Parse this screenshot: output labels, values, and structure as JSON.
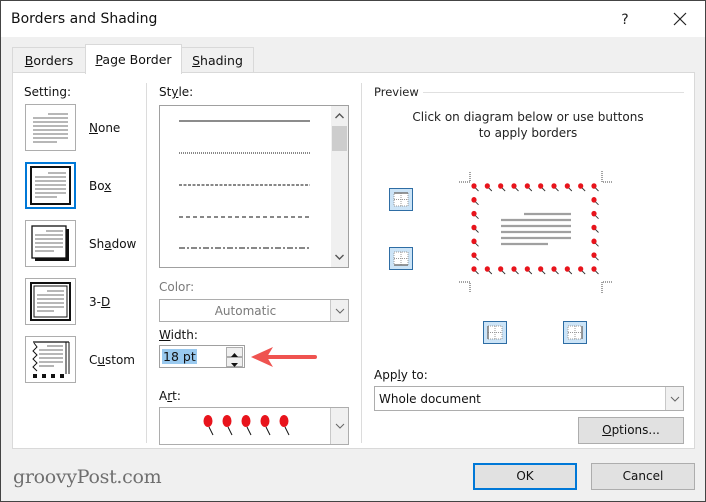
{
  "window": {
    "title": "Borders and Shading",
    "help_label": "?",
    "close_icon": "close-icon"
  },
  "tabs": [
    {
      "label": "Borders",
      "underline": "B",
      "rest": "orders",
      "active": false
    },
    {
      "label": "Page Border",
      "underline": "P",
      "rest": "age Border",
      "active": true
    },
    {
      "label": "Shading",
      "underline": "S",
      "rest": "hading",
      "active": false
    }
  ],
  "setting": {
    "label": "Setting:",
    "options": [
      {
        "pre": "",
        "u": "N",
        "post": "one",
        "label": "None",
        "selected": false
      },
      {
        "pre": "Bo",
        "u": "x",
        "post": "",
        "label": "Box",
        "selected": true
      },
      {
        "pre": "Sh",
        "u": "a",
        "post": "dow",
        "label": "Shadow",
        "selected": false
      },
      {
        "pre": "3-",
        "u": "D",
        "post": "",
        "label": "3-D",
        "selected": false
      },
      {
        "pre": "C",
        "u": "u",
        "post": "stom",
        "label": "Custom",
        "selected": false
      }
    ]
  },
  "style": {
    "label_pre": "St",
    "label_u": "y",
    "label_post": "le:",
    "line_styles": [
      "solid",
      "dotted",
      "dashed-small",
      "dashed-large",
      "dash-dot"
    ]
  },
  "color": {
    "label": "Color:",
    "value": "Automatic",
    "disabled": true
  },
  "width": {
    "label_u": "W",
    "label_post": "idth:",
    "value": "18 pt"
  },
  "art": {
    "label_pre": "A",
    "label_u": "r",
    "label_post": "t:",
    "value": "red pushpins",
    "color": "#e8141c"
  },
  "preview": {
    "label": "Preview",
    "instructions_line1": "Click on diagram below or use buttons",
    "instructions_line2": "to apply borders",
    "border_buttons": [
      "top-border",
      "bottom-border",
      "left-border",
      "right-border"
    ]
  },
  "apply_to": {
    "label_pre": "App",
    "label_u": "l",
    "label_post": "y to:",
    "value": "Whole document"
  },
  "buttons": {
    "options_u": "O",
    "options_post": "ptions...",
    "ok": "OK",
    "cancel": "Cancel"
  },
  "annotation": {
    "arrow_color": "#ef5350"
  },
  "watermark": "groovyPost.com"
}
